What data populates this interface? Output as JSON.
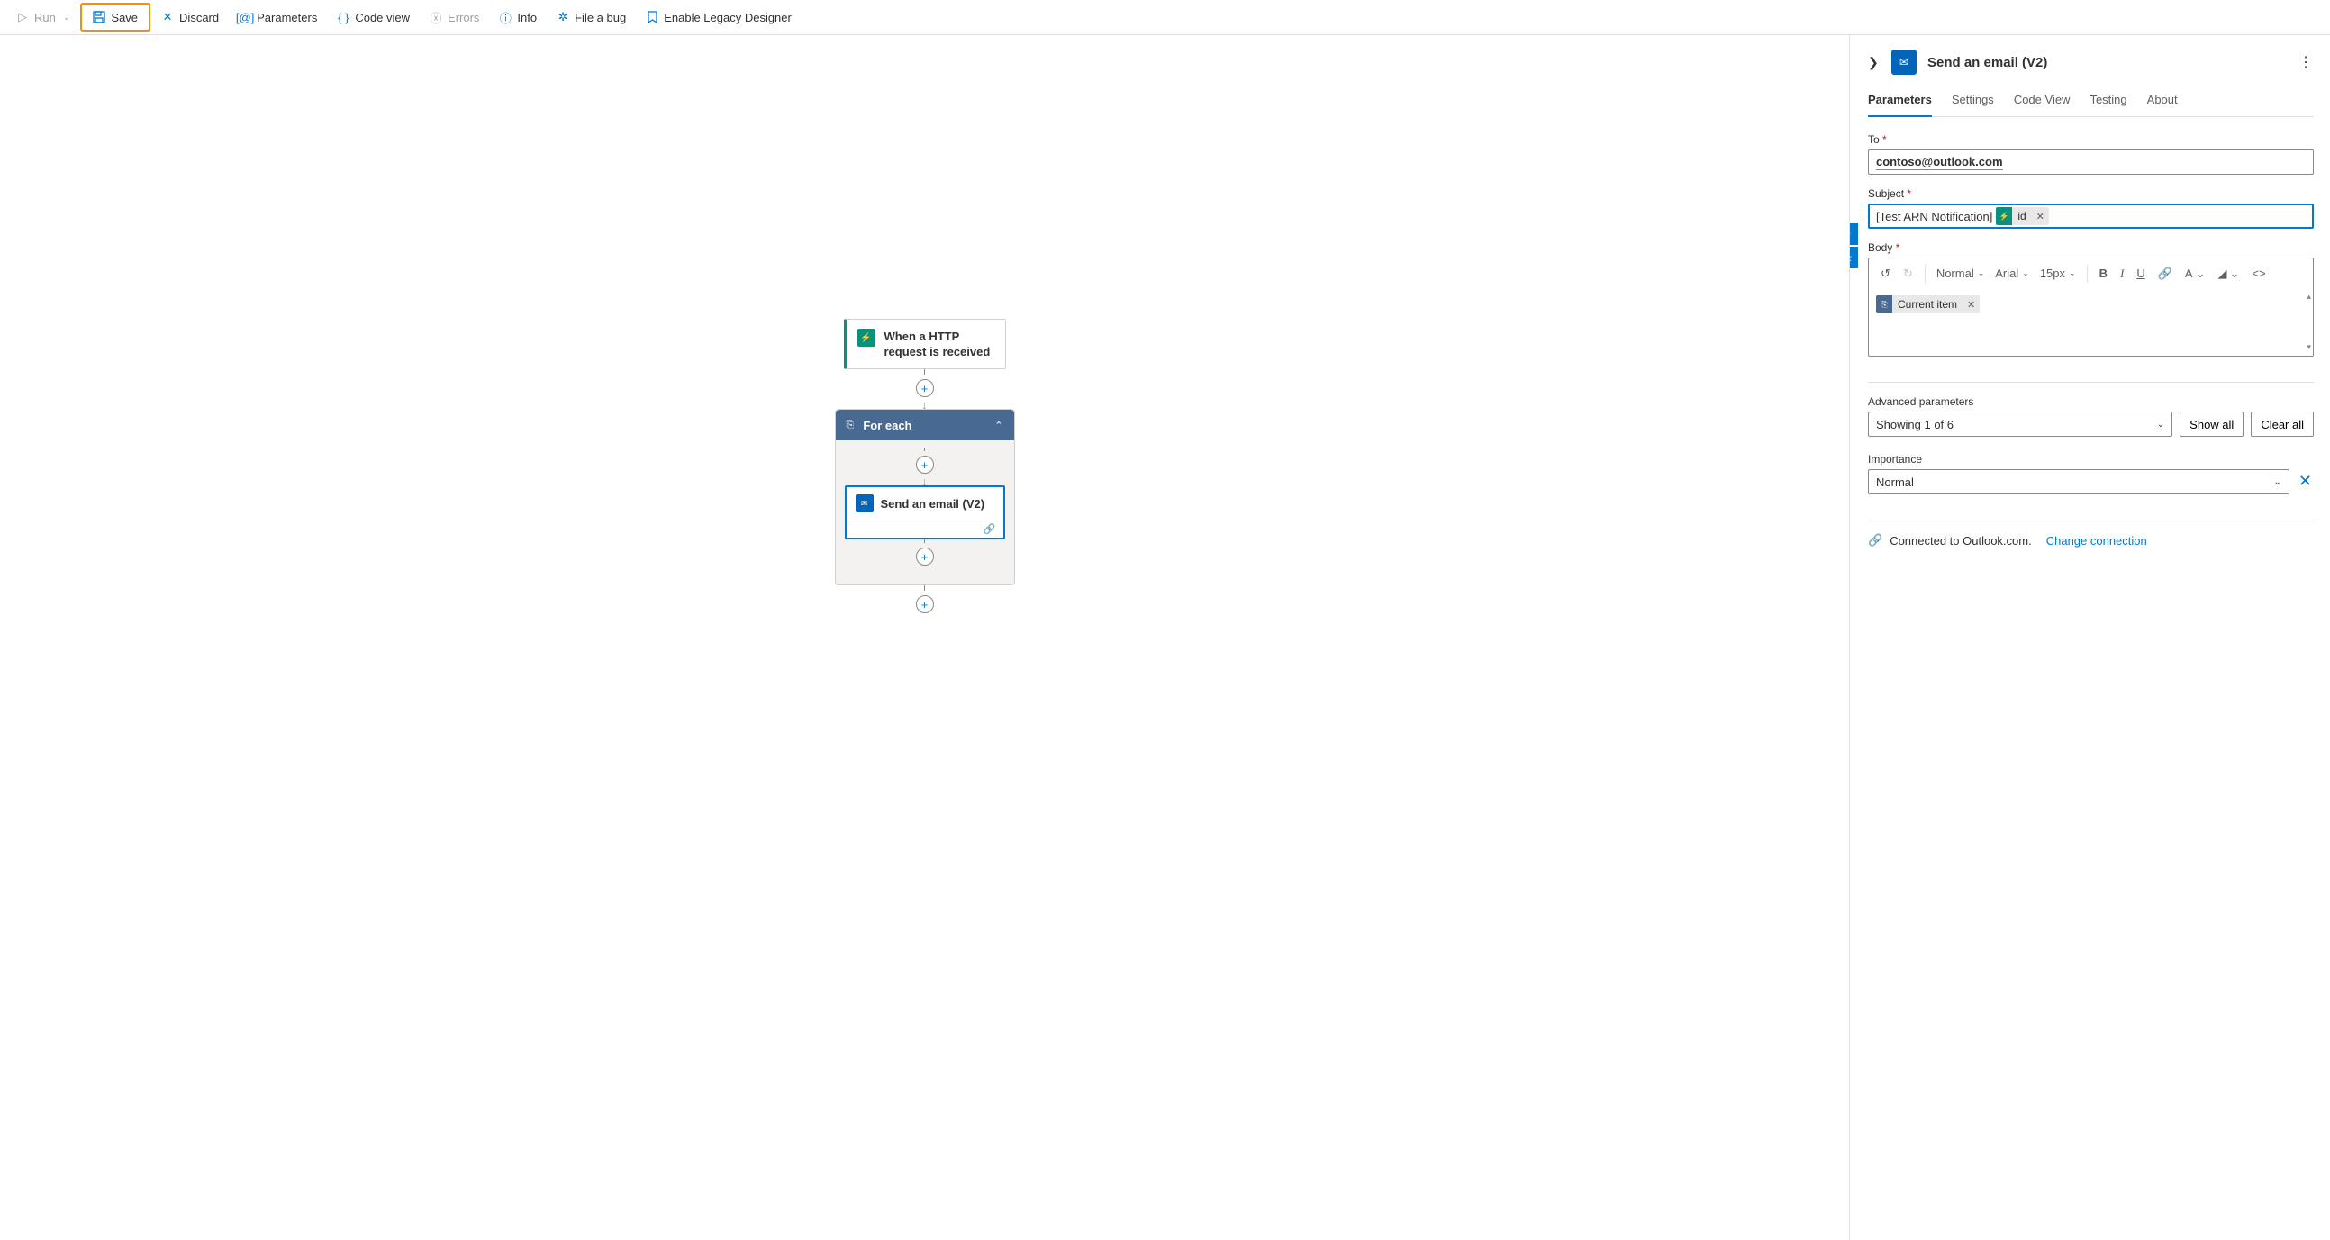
{
  "toolbar": {
    "run": "Run",
    "save": "Save",
    "discard": "Discard",
    "parameters": "Parameters",
    "code_view": "Code view",
    "errors": "Errors",
    "info": "Info",
    "file_bug": "File a bug",
    "legacy": "Enable Legacy Designer"
  },
  "flow": {
    "trigger": "When a HTTP request is received",
    "foreach": "For each",
    "action": "Send an email (V2)"
  },
  "panel": {
    "title": "Send an email (V2)",
    "tabs": {
      "parameters": "Parameters",
      "settings": "Settings",
      "code_view": "Code View",
      "testing": "Testing",
      "about": "About"
    },
    "to_label": "To",
    "to_value": "contoso@outlook.com",
    "subject_label": "Subject",
    "subject_text": "[Test ARN Notification]",
    "subject_token": "id",
    "body_label": "Body",
    "body_token": "Current item",
    "rte": {
      "font_style": "Normal",
      "font_family": "Arial",
      "font_size": "15px"
    },
    "advanced_label": "Advanced parameters",
    "advanced_showing": "Showing 1 of 6",
    "show_all": "Show all",
    "clear_all": "Clear all",
    "importance_label": "Importance",
    "importance_value": "Normal",
    "connected_text": "Connected to Outlook.com.",
    "change_connection": "Change connection"
  }
}
